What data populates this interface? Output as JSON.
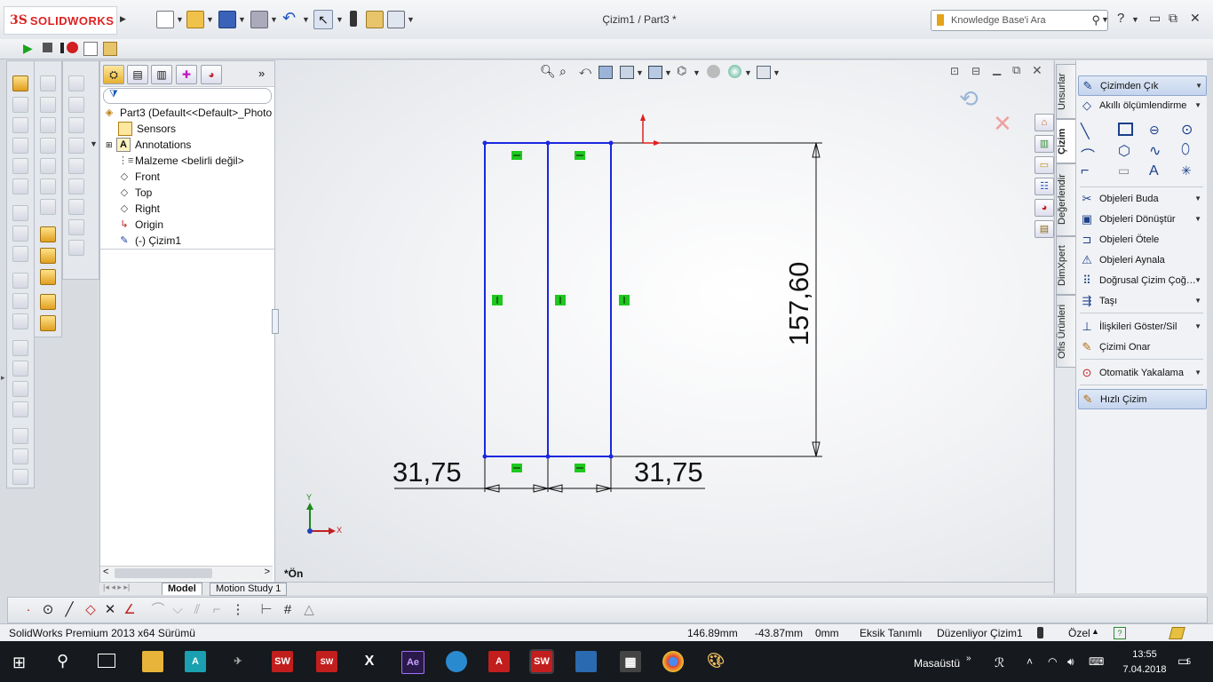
{
  "app": {
    "brand_ds": "3S",
    "brand_name": "SOLIDWORKS",
    "doc_title": "Çizim1 / Part3 *"
  },
  "search": {
    "placeholder": "Knowledge Base'i Ara"
  },
  "feature_tree": {
    "root": "Part3  (Default<<Default>_Photo",
    "items": [
      {
        "label": "Sensors",
        "icon": "sensor-icon"
      },
      {
        "label": "Annotations",
        "icon": "annotation-icon"
      },
      {
        "label": "Malzeme <belirli değil>",
        "icon": "material-icon"
      },
      {
        "label": "Front",
        "icon": "plane-icon"
      },
      {
        "label": "Top",
        "icon": "plane-icon"
      },
      {
        "label": "Right",
        "icon": "plane-icon"
      },
      {
        "label": "Origin",
        "icon": "origin-icon"
      },
      {
        "label": "(-) Çizim1",
        "icon": "sketch-icon"
      }
    ]
  },
  "bottom_tabs": {
    "model": "Model",
    "motion": "Motion Study 1"
  },
  "graphics": {
    "view_name": "*Ön",
    "dim_left": "31,75",
    "dim_right": "31,75",
    "dim_height": "157,60",
    "axis_x": "X",
    "axis_y": "Y"
  },
  "right_tabs": [
    "Unsurlar",
    "Çizim",
    "Değerlendir",
    "DimXpert",
    "Ofis Ürünleri"
  ],
  "right_panel": {
    "exit_sketch": "Çizimden Çık",
    "smart_dim": "Akıllı ölçümlendirme",
    "trim": "Objeleri Buda",
    "convert": "Objeleri Dönüştür",
    "offset": "Objeleri Ötele",
    "mirror": "Objeleri Aynala",
    "linear_pattern": "Doğrusal Çizim Çoğ…",
    "move": "Taşı",
    "relations": "İlişkileri Göster/Sil",
    "repair": "Çizimi Onar",
    "snap": "Otomatik Yakalama",
    "rapid": "Hızlı Çizim"
  },
  "status": {
    "product": "SolidWorks Premium 2013 x64 Sürümü",
    "x": "146.89mm",
    "y": "-43.87mm",
    "z": "0mm",
    "defined": "Eksik Tanımlı",
    "editing": "Düzenliyor Çizim1",
    "units": "Özel"
  },
  "taskbar": {
    "desktop": "Masaüstü",
    "time": "13:55",
    "date": "7.04.2018",
    "notifications": "5"
  },
  "colors": {
    "sketch_line": "#1a28e0",
    "relation_marker": "#1ec81e",
    "origin_arrow": "#e02020",
    "brand_red": "#d22222"
  }
}
